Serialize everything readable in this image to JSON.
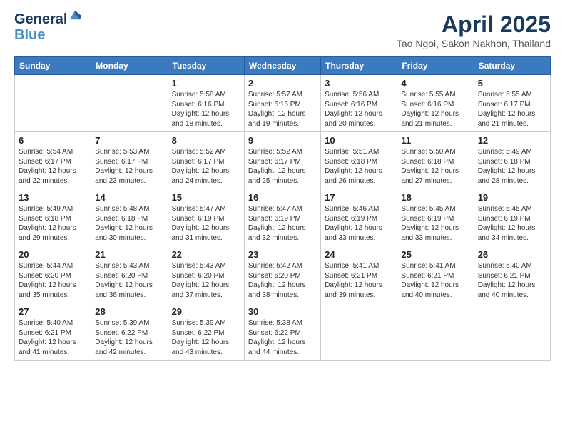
{
  "logo": {
    "line1": "General",
    "line2": "Blue"
  },
  "title": "April 2025",
  "subtitle": "Tao Ngoi, Sakon Nakhon, Thailand",
  "weekdays": [
    "Sunday",
    "Monday",
    "Tuesday",
    "Wednesday",
    "Thursday",
    "Friday",
    "Saturday"
  ],
  "weeks": [
    [
      {
        "day": "",
        "info": ""
      },
      {
        "day": "",
        "info": ""
      },
      {
        "day": "1",
        "info": "Sunrise: 5:58 AM\nSunset: 6:16 PM\nDaylight: 12 hours and 18 minutes."
      },
      {
        "day": "2",
        "info": "Sunrise: 5:57 AM\nSunset: 6:16 PM\nDaylight: 12 hours and 19 minutes."
      },
      {
        "day": "3",
        "info": "Sunrise: 5:56 AM\nSunset: 6:16 PM\nDaylight: 12 hours and 20 minutes."
      },
      {
        "day": "4",
        "info": "Sunrise: 5:55 AM\nSunset: 6:16 PM\nDaylight: 12 hours and 21 minutes."
      },
      {
        "day": "5",
        "info": "Sunrise: 5:55 AM\nSunset: 6:17 PM\nDaylight: 12 hours and 21 minutes."
      }
    ],
    [
      {
        "day": "6",
        "info": "Sunrise: 5:54 AM\nSunset: 6:17 PM\nDaylight: 12 hours and 22 minutes."
      },
      {
        "day": "7",
        "info": "Sunrise: 5:53 AM\nSunset: 6:17 PM\nDaylight: 12 hours and 23 minutes."
      },
      {
        "day": "8",
        "info": "Sunrise: 5:52 AM\nSunset: 6:17 PM\nDaylight: 12 hours and 24 minutes."
      },
      {
        "day": "9",
        "info": "Sunrise: 5:52 AM\nSunset: 6:17 PM\nDaylight: 12 hours and 25 minutes."
      },
      {
        "day": "10",
        "info": "Sunrise: 5:51 AM\nSunset: 6:18 PM\nDaylight: 12 hours and 26 minutes."
      },
      {
        "day": "11",
        "info": "Sunrise: 5:50 AM\nSunset: 6:18 PM\nDaylight: 12 hours and 27 minutes."
      },
      {
        "day": "12",
        "info": "Sunrise: 5:49 AM\nSunset: 6:18 PM\nDaylight: 12 hours and 28 minutes."
      }
    ],
    [
      {
        "day": "13",
        "info": "Sunrise: 5:49 AM\nSunset: 6:18 PM\nDaylight: 12 hours and 29 minutes."
      },
      {
        "day": "14",
        "info": "Sunrise: 5:48 AM\nSunset: 6:18 PM\nDaylight: 12 hours and 30 minutes."
      },
      {
        "day": "15",
        "info": "Sunrise: 5:47 AM\nSunset: 6:19 PM\nDaylight: 12 hours and 31 minutes."
      },
      {
        "day": "16",
        "info": "Sunrise: 5:47 AM\nSunset: 6:19 PM\nDaylight: 12 hours and 32 minutes."
      },
      {
        "day": "17",
        "info": "Sunrise: 5:46 AM\nSunset: 6:19 PM\nDaylight: 12 hours and 33 minutes."
      },
      {
        "day": "18",
        "info": "Sunrise: 5:45 AM\nSunset: 6:19 PM\nDaylight: 12 hours and 33 minutes."
      },
      {
        "day": "19",
        "info": "Sunrise: 5:45 AM\nSunset: 6:19 PM\nDaylight: 12 hours and 34 minutes."
      }
    ],
    [
      {
        "day": "20",
        "info": "Sunrise: 5:44 AM\nSunset: 6:20 PM\nDaylight: 12 hours and 35 minutes."
      },
      {
        "day": "21",
        "info": "Sunrise: 5:43 AM\nSunset: 6:20 PM\nDaylight: 12 hours and 36 minutes."
      },
      {
        "day": "22",
        "info": "Sunrise: 5:43 AM\nSunset: 6:20 PM\nDaylight: 12 hours and 37 minutes."
      },
      {
        "day": "23",
        "info": "Sunrise: 5:42 AM\nSunset: 6:20 PM\nDaylight: 12 hours and 38 minutes."
      },
      {
        "day": "24",
        "info": "Sunrise: 5:41 AM\nSunset: 6:21 PM\nDaylight: 12 hours and 39 minutes."
      },
      {
        "day": "25",
        "info": "Sunrise: 5:41 AM\nSunset: 6:21 PM\nDaylight: 12 hours and 40 minutes."
      },
      {
        "day": "26",
        "info": "Sunrise: 5:40 AM\nSunset: 6:21 PM\nDaylight: 12 hours and 40 minutes."
      }
    ],
    [
      {
        "day": "27",
        "info": "Sunrise: 5:40 AM\nSunset: 6:21 PM\nDaylight: 12 hours and 41 minutes."
      },
      {
        "day": "28",
        "info": "Sunrise: 5:39 AM\nSunset: 6:22 PM\nDaylight: 12 hours and 42 minutes."
      },
      {
        "day": "29",
        "info": "Sunrise: 5:39 AM\nSunset: 6:22 PM\nDaylight: 12 hours and 43 minutes."
      },
      {
        "day": "30",
        "info": "Sunrise: 5:38 AM\nSunset: 6:22 PM\nDaylight: 12 hours and 44 minutes."
      },
      {
        "day": "",
        "info": ""
      },
      {
        "day": "",
        "info": ""
      },
      {
        "day": "",
        "info": ""
      }
    ]
  ]
}
